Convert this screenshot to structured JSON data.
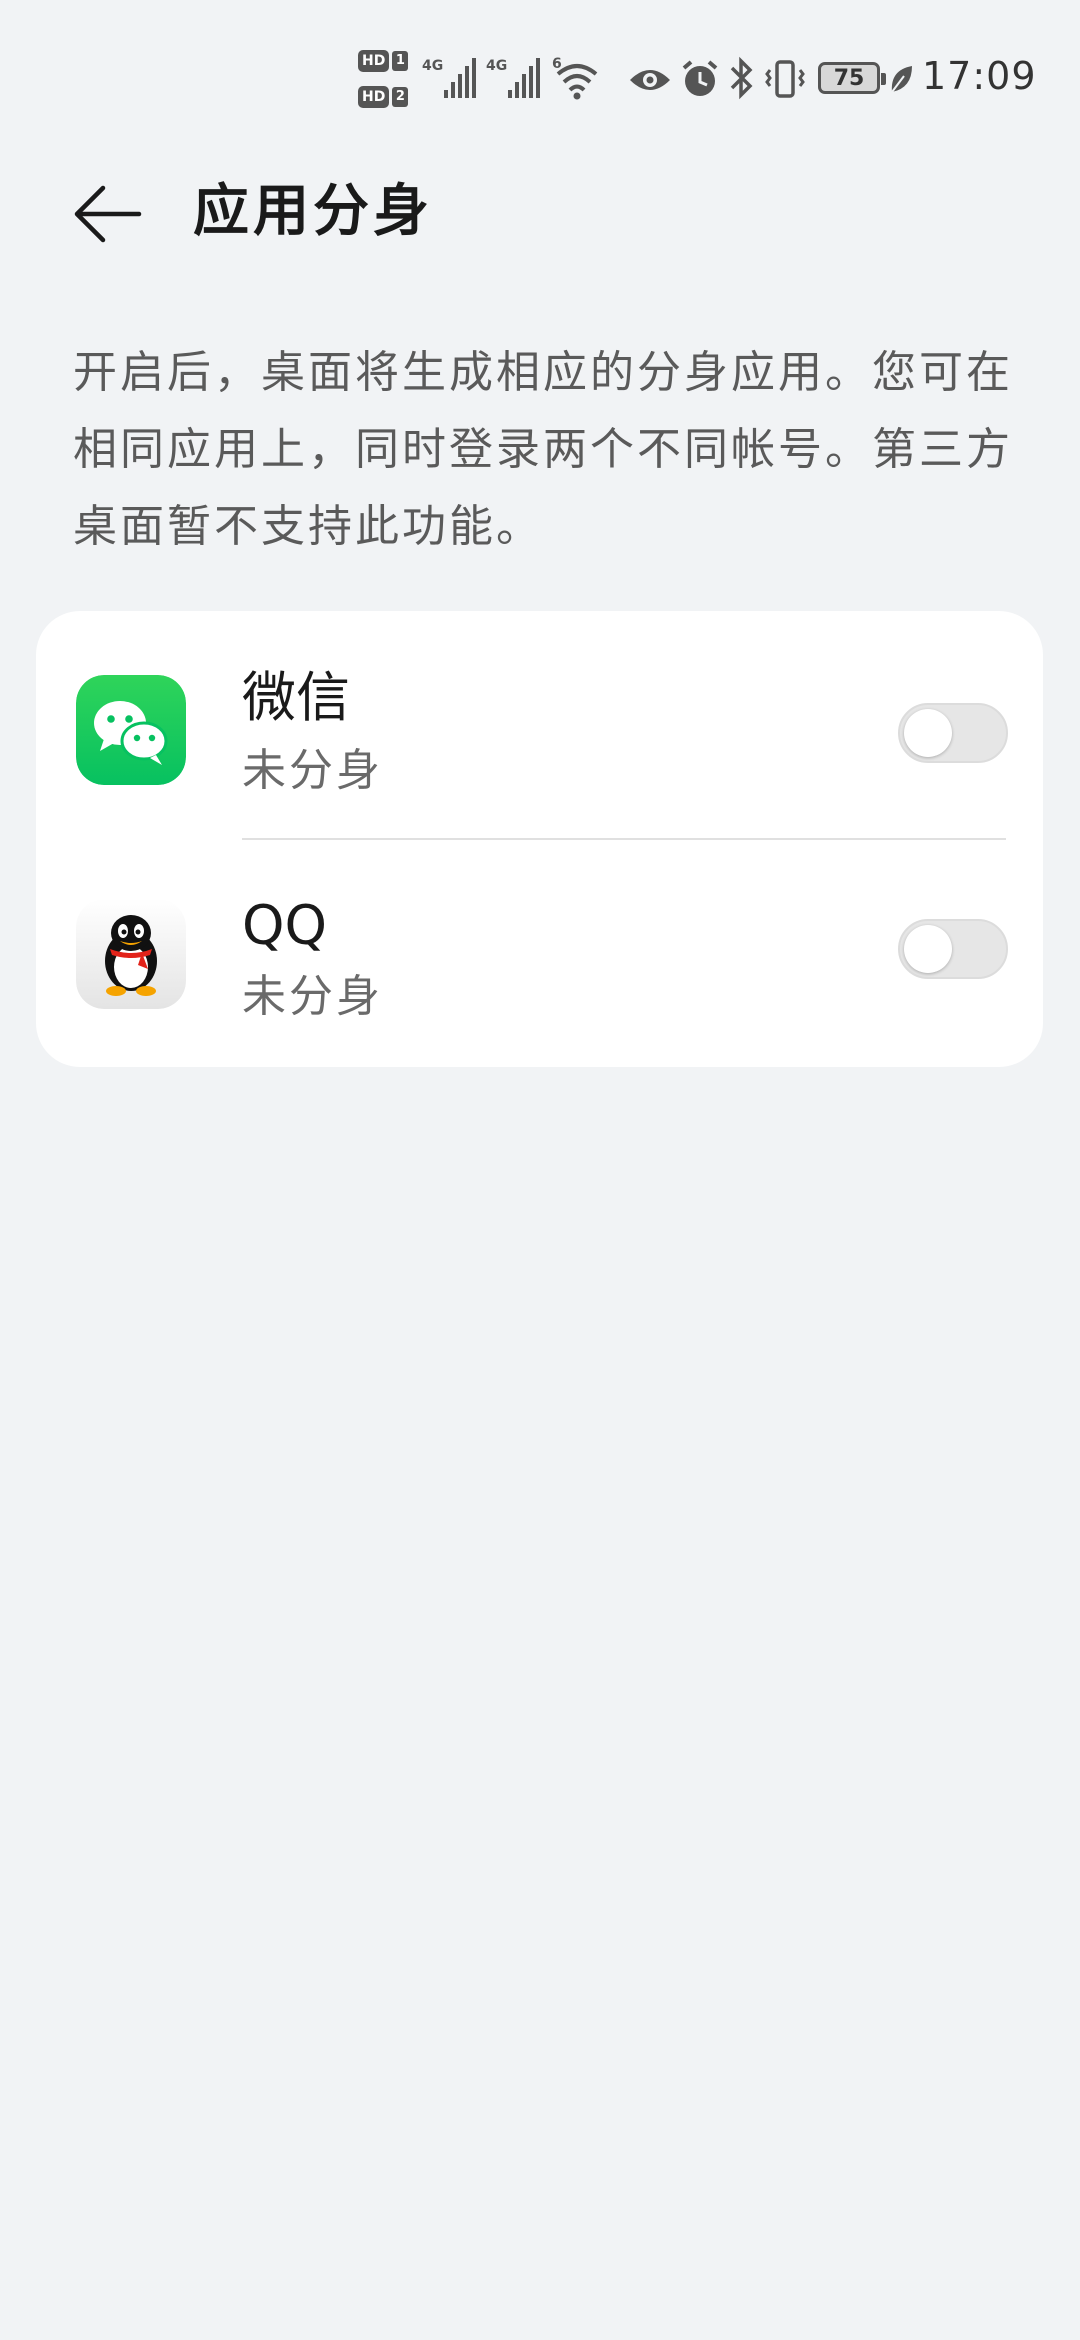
{
  "status_bar": {
    "sim1_label": "HD",
    "sim1_index": "1",
    "sim2_label": "HD",
    "sim2_index": "2",
    "network1": "4G",
    "network2": "4G",
    "wifi_label": "6",
    "battery_level": "75",
    "time": "17:09",
    "icons": [
      "signal-icon",
      "signal-icon",
      "wifi-icon",
      "eye-icon",
      "alarm-icon",
      "bluetooth-icon",
      "vibrate-icon",
      "battery-icon",
      "leaf-icon"
    ]
  },
  "header": {
    "back_icon": "arrow-left-icon",
    "title": "应用分身"
  },
  "description": "开启后，桌面将生成相应的分身应用。您可在相同应用上，同时登录两个不同帐号。第三方桌面暂不支持此功能。",
  "apps": [
    {
      "name": "微信",
      "status": "未分身",
      "enabled": false,
      "icon": "wechat-icon",
      "icon_color": "#07c160"
    },
    {
      "name": "QQ",
      "status": "未分身",
      "enabled": false,
      "icon": "qq-penguin-icon",
      "icon_color": "#111111"
    }
  ],
  "colors": {
    "background": "#f1f3f5",
    "card": "#ffffff",
    "toggle_off": "#e6e6e6",
    "wechat_green": "#07c160"
  }
}
